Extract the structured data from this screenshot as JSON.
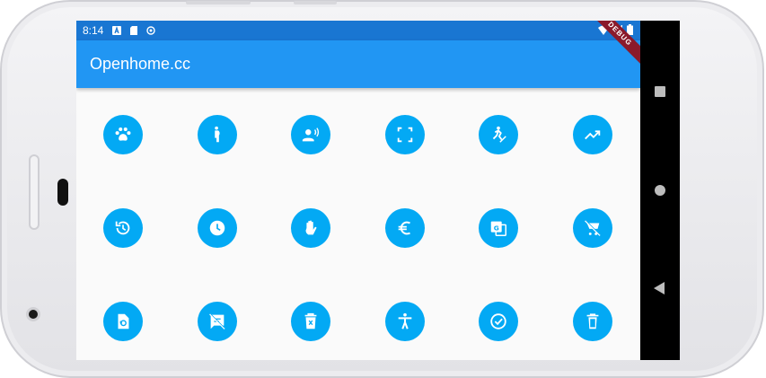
{
  "status_bar": {
    "time": "8:14",
    "left_icons": [
      "font-download-icon",
      "sd-card-icon",
      "sync-icon"
    ],
    "right_icons": [
      "wifi-icon",
      "signal-icon",
      "battery-icon"
    ]
  },
  "app_bar": {
    "title": "Openhome.cc"
  },
  "debug_banner": {
    "label": "DEBUG"
  },
  "colors": {
    "status_bar": "#1976d2",
    "app_bar": "#2196f3",
    "icon_button": "#03a9f4",
    "background": "#fafafa",
    "debug_ribbon": "#8b1a2b"
  },
  "icons": [
    {
      "name": "pets-icon"
    },
    {
      "name": "pregnant-woman-icon"
    },
    {
      "name": "record-voice-over-icon"
    },
    {
      "name": "crop-free-icon"
    },
    {
      "name": "sports-hockey-icon"
    },
    {
      "name": "trending-up-icon"
    },
    {
      "name": "restore-icon"
    },
    {
      "name": "schedule-icon"
    },
    {
      "name": "pan-tool-icon"
    },
    {
      "name": "euro-icon"
    },
    {
      "name": "g-translate-icon"
    },
    {
      "name": "remove-shopping-cart-icon"
    },
    {
      "name": "restore-page-icon"
    },
    {
      "name": "speaker-notes-off-icon"
    },
    {
      "name": "delete-forever-icon"
    },
    {
      "name": "accessibility-icon"
    },
    {
      "name": "check-circle-outline-icon"
    },
    {
      "name": "delete-icon"
    }
  ],
  "nav_bar": [
    "recents-button",
    "home-button",
    "back-button"
  ]
}
